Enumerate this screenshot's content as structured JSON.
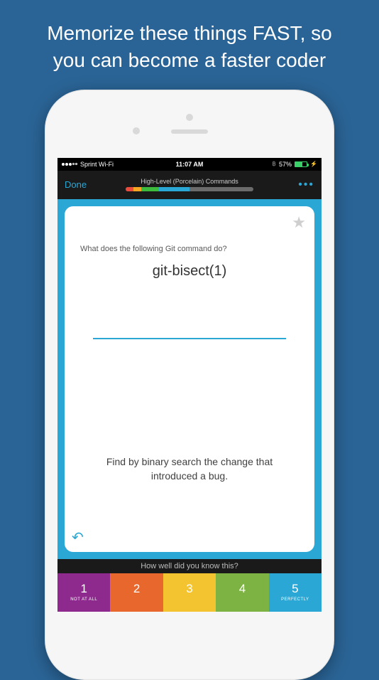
{
  "promo": {
    "line1": "Memorize these things FAST, so",
    "line2": "you can become a faster coder"
  },
  "status_bar": {
    "carrier": "Sprint Wi-Fi",
    "time": "11:07 AM",
    "battery_pct": "57%",
    "bluetooth": "1"
  },
  "nav": {
    "done": "Done",
    "title": "High-Level (Porcelain) Commands",
    "more": "•••",
    "progress_segments": [
      {
        "color": "#e94b3c",
        "width": "6%"
      },
      {
        "color": "#f5a623",
        "width": "6%"
      },
      {
        "color": "#3dbb3d",
        "width": "14%"
      },
      {
        "color": "#2aa7d4",
        "width": "24%"
      }
    ]
  },
  "card": {
    "question_label": "What does the following Git command do?",
    "command": "git-bisect(1)",
    "answer": "Find by binary search the change that introduced a bug.",
    "star_icon": "★",
    "undo_icon": "↶"
  },
  "rating": {
    "prompt": "How well did you know this?",
    "buttons": [
      {
        "num": "1",
        "sub": "NOT AT ALL",
        "color": "#8e2a8e"
      },
      {
        "num": "2",
        "sub": "",
        "color": "#e8672c"
      },
      {
        "num": "3",
        "sub": "",
        "color": "#f4c430"
      },
      {
        "num": "4",
        "sub": "",
        "color": "#7cb342"
      },
      {
        "num": "5",
        "sub": "PERFECTLY",
        "color": "#2aa7d4"
      }
    ]
  }
}
